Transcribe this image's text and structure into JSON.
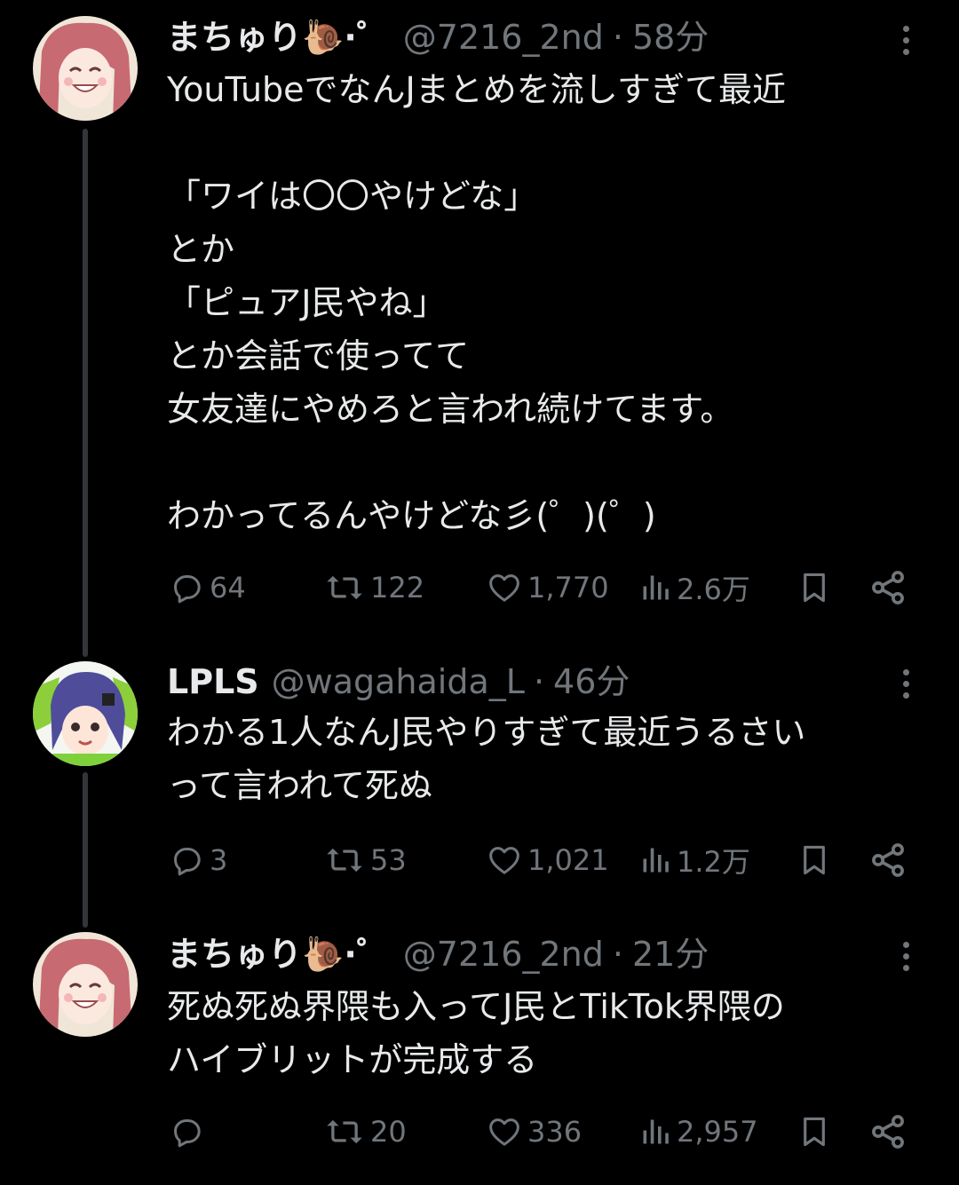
{
  "tweets": [
    {
      "name": "まちゅり🐌⋅゜",
      "handle": "@7216_2nd",
      "sep": "·",
      "time": "58分",
      "lines": [
        "YouTubeでなんJまとめを流しすぎて最近",
        "",
        "「ワイは〇〇やけどな」",
        "とか",
        "「ピュアJ民やね」",
        "とか会話で使ってて",
        "女友達にやめろと言われ続けてます。",
        "",
        "わかってるんやけどな彡(゜)(゜)"
      ],
      "replies": "64",
      "retweets": "122",
      "likes": "1,770",
      "views": "2.6万"
    },
    {
      "name": "LPLS",
      "handle": "@wagahaida_L",
      "sep": "·",
      "time": "46分",
      "lines": [
        "わかる1人なんJ民やりすぎて最近うるさい",
        "って言われて死ぬ"
      ],
      "replies": "3",
      "retweets": "53",
      "likes": "1,021",
      "views": "1.2万"
    },
    {
      "name": "まちゅり🐌⋅゜",
      "handle": "@7216_2nd",
      "sep": "·",
      "time": "21分",
      "lines": [
        "死ぬ死ぬ界隈も入ってJ民とTikTok界隈の",
        "ハイブリットが完成する"
      ],
      "replies": "",
      "retweets": "20",
      "likes": "336",
      "views": "2,957"
    }
  ],
  "icons": {
    "reply": "reply-icon",
    "retweet": "retweet-icon",
    "like": "heart-icon",
    "views": "views-icon",
    "bookmark": "bookmark-icon",
    "share": "share-icon",
    "more": "more-dots-icon"
  },
  "colors": {
    "background": "#000000",
    "text": "#e7e9ea",
    "muted": "#71767b",
    "thread_line": "#333639"
  }
}
